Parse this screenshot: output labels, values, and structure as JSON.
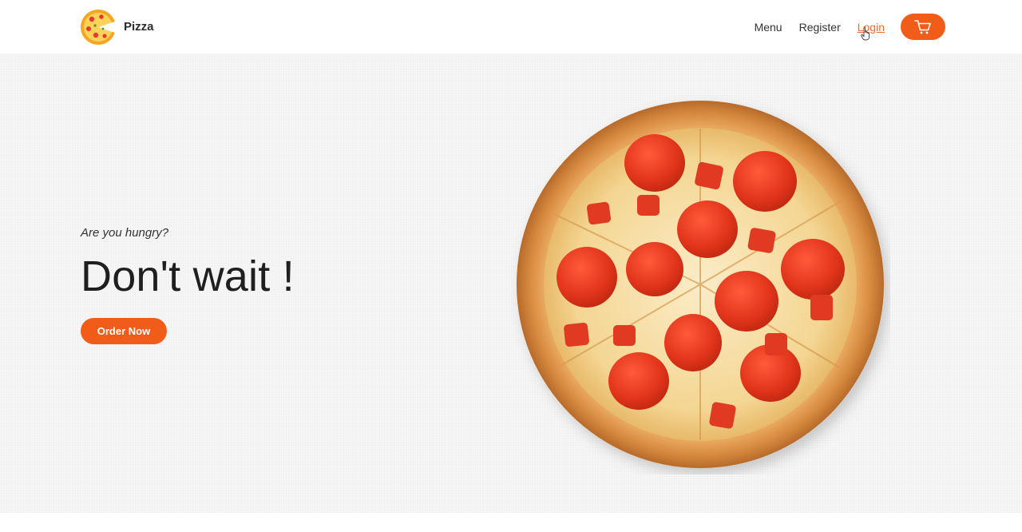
{
  "brand": {
    "name": "Pizza",
    "logo_icon": "pizza-logo-icon"
  },
  "nav": {
    "items": [
      {
        "label": "Menu"
      },
      {
        "label": "Register"
      },
      {
        "label": "Login"
      }
    ],
    "cart_icon": "cart-icon"
  },
  "hero": {
    "subtitle": "Are you hungry?",
    "title": "Don't wait !",
    "order_button": "Order Now",
    "image_icon": "pepperoni-pizza-image"
  },
  "colors": {
    "accent": "#f25c19",
    "active_link": "#f26b27",
    "hero_bg": "#f5f5f5"
  }
}
